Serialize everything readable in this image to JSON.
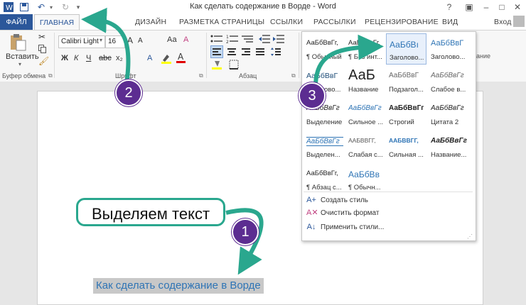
{
  "window": {
    "title": "Как сделать содержание в Ворде - Word",
    "signin": "Вход",
    "help": "?",
    "min": "–",
    "max": "□",
    "close": "✕"
  },
  "tabs": [
    {
      "label": "ФАЙЛ"
    },
    {
      "label": "ГЛАВНАЯ"
    },
    {
      "label": "ДИЗАЙН"
    },
    {
      "label": "РАЗМЕТКА СТРАНИЦЫ"
    },
    {
      "label": "ССЫЛКИ"
    },
    {
      "label": "РАССЫЛКИ"
    },
    {
      "label": "РЕЦЕНЗИРОВАНИЕ"
    },
    {
      "label": "ВИД"
    }
  ],
  "ribbon": {
    "paste_label": "Вставить",
    "clipboard_group": "Буфер обмена",
    "font_group": "Шрифт",
    "paragraph_group": "Абзац",
    "font_name": "Calibri Light",
    "font_size": "16",
    "bold": "Ж",
    "italic": "К",
    "underline": "Ч",
    "case_btn": "Аа",
    "grow_font": "A",
    "shrink_font": "A"
  },
  "gallery": {
    "rows": [
      [
        {
          "preview": "АаБбВвГг,",
          "name": "¶ Обычный"
        },
        {
          "preview": "АаБбВвГг,",
          "name": "¶ Без инт..."
        },
        {
          "preview": "АаБбВı",
          "name": "Заголово..."
        },
        {
          "preview": "АаБбВвГ",
          "name": "Заголово..."
        }
      ],
      [
        {
          "preview": "АаБбВвГ",
          "name": "Заголово..."
        },
        {
          "preview": "АаБ",
          "name": "Название"
        },
        {
          "preview": "АаБбВвГ",
          "name": "Подзагол..."
        },
        {
          "preview": "АаБбВвГг",
          "name": "Слабое в..."
        }
      ],
      [
        {
          "preview": "АаБбВвГг",
          "name": "Выделение"
        },
        {
          "preview": "АаБбВвГг",
          "name": "Сильное ..."
        },
        {
          "preview": "АаБбВвГг",
          "name": "Строгий"
        },
        {
          "preview": "АаБбВвГг",
          "name": "Цитата 2"
        }
      ],
      [
        {
          "preview": "АаБбВвГг",
          "name": "Выделен..."
        },
        {
          "preview": "ААБВВГГ,",
          "name": "Слабая с..."
        },
        {
          "preview": "ААБВВГГ,",
          "name": "Сильная ..."
        },
        {
          "preview": "АаБбВвГг",
          "name": "Название..."
        }
      ],
      [
        {
          "preview": "АаБбВвГг,",
          "name": "¶ Абзац с..."
        },
        {
          "preview": "АаБбВв",
          "name": "¶ Обычн..."
        }
      ]
    ],
    "menu": [
      {
        "icon": "A+",
        "label": "Создать стиль"
      },
      {
        "icon": "A✕",
        "label": "Очистить формат"
      },
      {
        "icon": "A↓",
        "label": "Применить стили..."
      }
    ]
  },
  "document": {
    "heading": "Как сделать содержание в Ворде"
  },
  "annotations": {
    "callout": "Выделяем текст",
    "badge1": "1",
    "badge2": "2",
    "badge3": "3"
  },
  "colors": {
    "accent": "#2b579a",
    "annotation_teal": "#2aa78e",
    "badge_purple": "#5c2d91",
    "heading_blue": "#2e74b5"
  }
}
